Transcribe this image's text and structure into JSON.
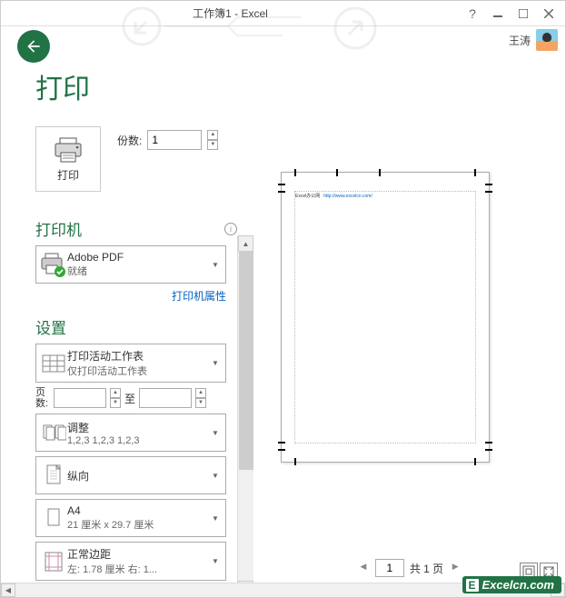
{
  "titlebar": {
    "title": "工作簿1 - Excel"
  },
  "user": {
    "name": "王涛"
  },
  "page": {
    "title": "打印"
  },
  "print_button": {
    "label": "打印"
  },
  "copies": {
    "label": "份数:",
    "value": "1"
  },
  "printer": {
    "section_title": "打印机",
    "name": "Adobe PDF",
    "status": "就绪",
    "properties_link": "打印机属性"
  },
  "settings": {
    "section_title": "设置",
    "scope": {
      "main": "打印活动工作表",
      "sub": "仅打印活动工作表"
    },
    "pages": {
      "label": "页数:",
      "to": "至",
      "from": "",
      "to_val": ""
    },
    "collation": {
      "main": "调整",
      "sub": "1,2,3   1,2,3   1,2,3"
    },
    "orientation": {
      "main": "纵向",
      "sub": ""
    },
    "paper": {
      "main": "A4",
      "sub": "21 厘米 x 29.7 厘米"
    },
    "margins": {
      "main": "正常边距",
      "sub": "左: 1.78 厘米  右: 1..."
    }
  },
  "preview": {
    "text1": "Excel办公网",
    "text2": "http://www.excelcn.com/"
  },
  "pager": {
    "current": "1",
    "total_label": "共 1 页"
  },
  "watermark": {
    "letter": "E",
    "text": "Excelcn.com"
  }
}
